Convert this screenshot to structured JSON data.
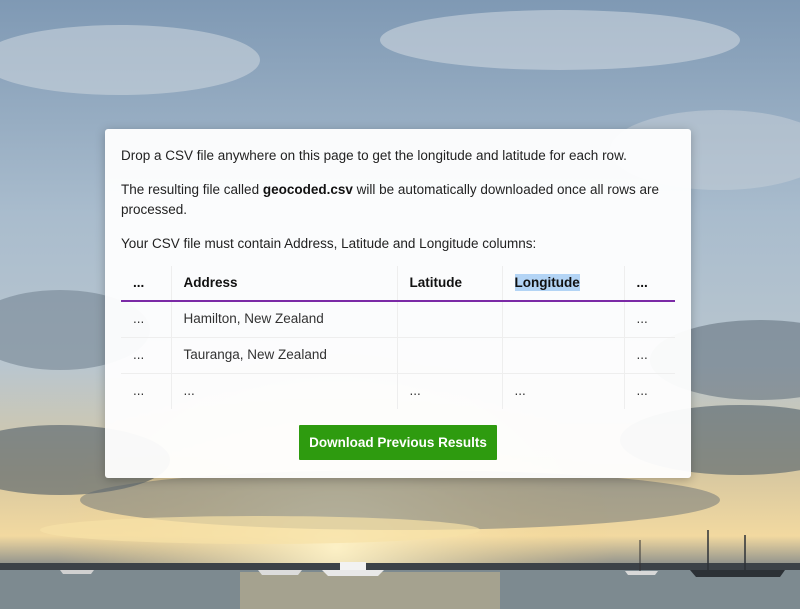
{
  "intro": {
    "line1": "Drop a CSV file anywhere on this page to get the longitude and latitude for each row.",
    "line2_prefix": "The resulting file called ",
    "line2_filename": "geocoded.csv",
    "line2_suffix": " will be automatically downloaded once all rows are processed.",
    "line3": "Your CSV file must contain Address, Latitude and Longitude columns:"
  },
  "table": {
    "headers": [
      "...",
      "Address",
      "Latitude",
      "Longitude",
      "..."
    ],
    "rows": [
      [
        "...",
        "Hamilton, New Zealand",
        "",
        "",
        "..."
      ],
      [
        "...",
        "Tauranga, New Zealand",
        "",
        "",
        "..."
      ],
      [
        "...",
        "...",
        "...",
        "...",
        "..."
      ]
    ]
  },
  "actions": {
    "download_label": "Download Previous Results"
  },
  "colors": {
    "accent_purple": "#7b2aa6",
    "button_green": "#2e9b0f",
    "selection_highlight": "#b3d4f5"
  }
}
